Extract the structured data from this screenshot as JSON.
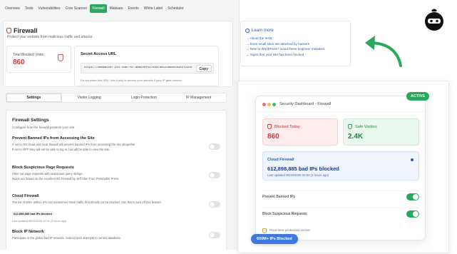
{
  "nav": {
    "tabs": [
      "Overview",
      "Tests",
      "Vulnerabilities",
      "Core Scanner",
      "Firewall",
      "Malware",
      "Events",
      "White Label",
      "Scheduler"
    ],
    "active_index": 4
  },
  "header": {
    "title": "Firewall",
    "subtitle": "Protect your website from malicious traffic and attacks"
  },
  "stat": {
    "label": "Total Blocked Visits",
    "value": "860"
  },
  "secret_url": {
    "label": "Secret Access URL",
    "url": "https://webmaster.pro.com/?sr-WHN4cef5970daTa0523a0855b3b2f23c6",
    "copy_label": "Copy",
    "note": "Do not share this URL! Use it only to access your website if your IP gets banned."
  },
  "sub_tabs": [
    "Settings",
    "Visitor Logging",
    "Login Protection",
    "IP Management"
  ],
  "settings": {
    "title": "Firewall Settings",
    "subtitle": "Configure how the firewall protects your site",
    "items": [
      {
        "name": "Prevent Banned IPs from Accessing the Site",
        "desc1": "If set to ON cloud and local firewall will prevent banned IPs from accessing the site altogether.",
        "desc2": "If set to OFF they will not be able to log in, but will be able to view the site."
      },
      {
        "name": "Block Suspicious Page Requests",
        "desc1": "Filter out page requests with suspicious query strings.",
        "desc2": "Rules are based on the excellent 8G Firewall by Jeff Starr from Perishable Press."
      },
      {
        "name": "Cloud Firewall",
        "desc1": "The list of 600+ million IPs can sometimes block traffic that should not be blocked. Use this to turn off this feature.",
        "badge": "612,898,885 bad IPs blocked",
        "meta": "Last updated 05/19/2025 02:54 (3 hours ago)"
      },
      {
        "name": "Block IP Network",
        "desc1": "Participate in the global bad IP network. Submit hack attempts to central database."
      }
    ]
  },
  "learn": {
    "title": "Learn more",
    "links": [
      "→ About the tests",
      "→ Even small sites are attacked by hackers",
      "→ New to WordPress? avoid these beginner mistakes.",
      "→ Signs that your site has been hacked"
    ]
  },
  "overlay": {
    "window_title": "Security Dashboard - Firewall",
    "active_badge": "ACTIVE",
    "blocked_today_label": "Blocked Today",
    "blocked_today_value": "860",
    "safe_visitors_label": "Safe Visitors",
    "safe_visitors_value": "2.4K",
    "cloud_label": "Cloud Firewall",
    "cloud_value": "612,898,885 bad IPs blocked",
    "cloud_meta": "Last updated 05/19/2025 02:54 (3 hours ago)",
    "row1": "Prevent Banned IPs",
    "row2": "Block Suspicious Requests",
    "realtime": "Real-time protection active",
    "pill": "600M+ IPs Blocked"
  },
  "colors": {
    "accent_green": "#2aa85c",
    "danger_red": "#d23a3a",
    "link_blue": "#2b5bb8",
    "pill_blue": "#3d79e0"
  }
}
